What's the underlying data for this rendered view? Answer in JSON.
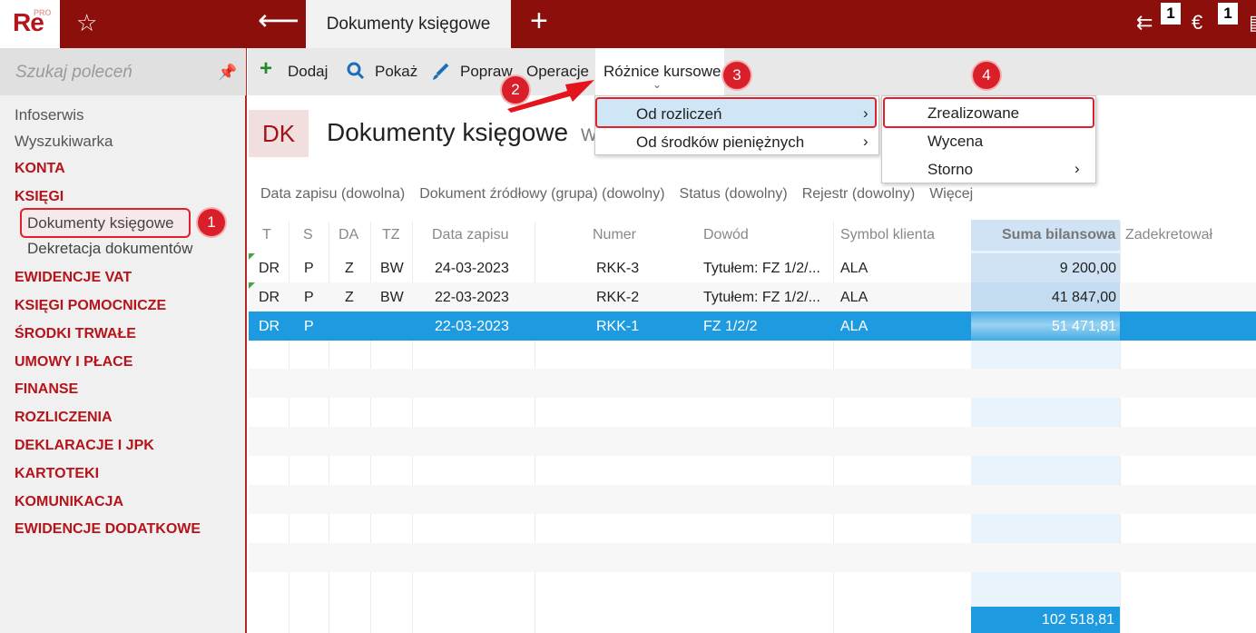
{
  "app": {
    "logo": "Re",
    "logo_sup": "PRO",
    "active_tab": "Dokumenty księgowe",
    "badge_a": "1",
    "badge_b": "1"
  },
  "sidebar": {
    "search_placeholder": "Szukaj poleceń",
    "items": [
      {
        "label": "Infoserwis"
      },
      {
        "label": "Wyszukiwarka"
      },
      {
        "label": "KONTA"
      },
      {
        "label": "KSIĘGI"
      },
      {
        "label": "Dokumenty księgowe"
      },
      {
        "label": "Dekretacja dokumentów"
      },
      {
        "label": "EWIDENCJE VAT"
      },
      {
        "label": "KSIĘGI POMOCNICZE"
      },
      {
        "label": "ŚRODKI TRWAŁE"
      },
      {
        "label": "UMOWY I PŁACE"
      },
      {
        "label": "FINANSE"
      },
      {
        "label": "ROZLICZENIA"
      },
      {
        "label": "DEKLARACJE I JPK"
      },
      {
        "label": "KARTOTEKI"
      },
      {
        "label": "KOMUNIKACJA"
      },
      {
        "label": "EWIDENCJE DODATKOWE"
      }
    ]
  },
  "toolbar": {
    "add": "Dodaj",
    "show": "Pokaż",
    "edit": "Popraw",
    "operations": "Operacje",
    "fx": "Różnice kursowe"
  },
  "header": {
    "code": "DK",
    "title": "Dokumenty księgowe",
    "subtitle": "W"
  },
  "filters": [
    "Data zapisu (dowolna)",
    "Dokument źródłowy (grupa) (dowolny)",
    "Status (dowolny)",
    "Rejestr (dowolny)",
    "Więcej"
  ],
  "grid": {
    "columns": [
      "T",
      "S",
      "DA",
      "TZ",
      "Data zapisu",
      "Numer",
      "Dowód",
      "Symbol klienta",
      "Suma bilansowa",
      "Zadekretował"
    ],
    "rows": [
      {
        "t": "DR",
        "s": "P",
        "da": "Z",
        "tz": "BW",
        "date": "24-03-2023",
        "num": "RKK-3",
        "dowod": "Tytułem: FZ 1/2/...",
        "client": "ALA",
        "sum": "9 200,00"
      },
      {
        "t": "DR",
        "s": "P",
        "da": "Z",
        "tz": "BW",
        "date": "22-03-2023",
        "num": "RKK-2",
        "dowod": "Tytułem: FZ 1/2/...",
        "client": "ALA",
        "sum": "41 847,00"
      },
      {
        "t": "DR",
        "s": "P",
        "da": "",
        "tz": "",
        "date": "22-03-2023",
        "num": "RKK-1",
        "dowod": "FZ 1/2/2",
        "client": "ALA",
        "sum": "51 471,81"
      }
    ],
    "total": "102 518,81"
  },
  "menu": {
    "level1": [
      {
        "label": "Od rozliczeń"
      },
      {
        "label": "Od środków pieniężnych"
      }
    ],
    "level2": [
      {
        "label": "Zrealizowane"
      },
      {
        "label": "Wycena"
      },
      {
        "label": "Storno"
      }
    ],
    "chevron": "›"
  },
  "annotations": [
    "1",
    "2",
    "3",
    "4"
  ],
  "colors": {
    "brand": "#8c0f0c",
    "accent": "#b5141a",
    "selection": "#1e9be0",
    "highlight": "#e0202a"
  }
}
